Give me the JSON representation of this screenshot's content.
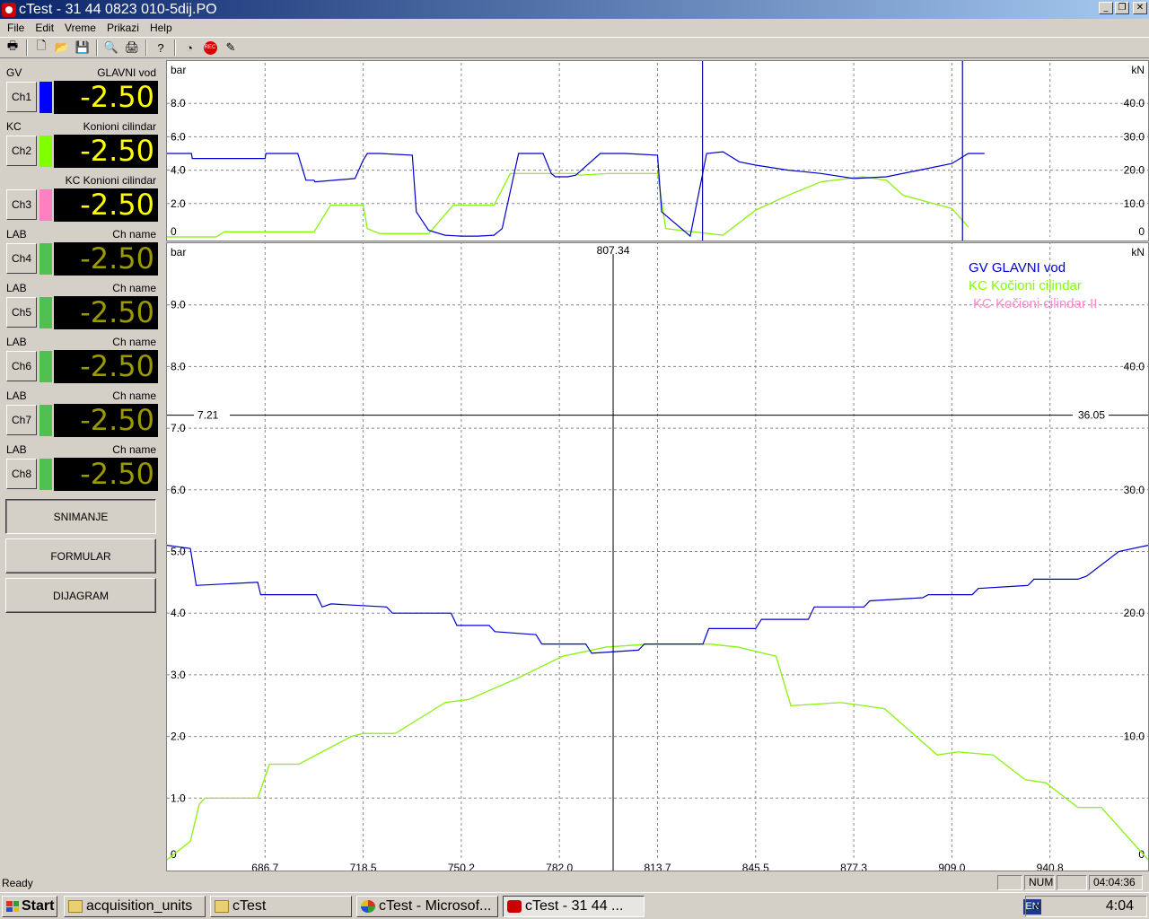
{
  "window": {
    "title": "cTest - 31 44 0823 010-5dij.PO"
  },
  "menu": [
    "File",
    "Edit",
    "Vreme",
    "Prikazi",
    "Help"
  ],
  "toolbar_icons": [
    "print-icon",
    "new-file-icon",
    "open-folder-icon",
    "save-icon",
    "print-preview-icon",
    "printer-icon",
    "help-icon",
    "gauge-icon",
    "rec-icon",
    "tool-icon"
  ],
  "channels": [
    {
      "code": "GV",
      "name": "GLAVNI vod",
      "button": "Ch1",
      "value": "-2.50",
      "color": "#0000ff",
      "active": true
    },
    {
      "code": "KC",
      "name": "Konioni cilindar",
      "button": "Ch2",
      "value": "-2.50",
      "color": "#80ff00",
      "active": true
    },
    {
      "code": "",
      "name": "KC Konioni cilindar",
      "button": "Ch3",
      "value": "-2.50",
      "color": "#ff80c0",
      "active": true
    },
    {
      "code": "LAB",
      "name": "Ch name",
      "button": "Ch4",
      "value": "-2.50",
      "color": "#50c050",
      "active": false
    },
    {
      "code": "LAB",
      "name": "Ch name",
      "button": "Ch5",
      "value": "-2.50",
      "color": "#50c050",
      "active": false
    },
    {
      "code": "LAB",
      "name": "Ch name",
      "button": "Ch6",
      "value": "-2.50",
      "color": "#50c050",
      "active": false
    },
    {
      "code": "LAB",
      "name": "Ch name",
      "button": "Ch7",
      "value": "-2.50",
      "color": "#50c050",
      "active": false
    },
    {
      "code": "LAB",
      "name": "Ch name",
      "button": "Ch8",
      "value": "-2.50",
      "color": "#50c050",
      "active": false
    }
  ],
  "buttons": {
    "snimanje": "SNIMANJE",
    "formular": "FORMULAR",
    "dijagram": "DIJAGRAM"
  },
  "status": {
    "ready": "Ready",
    "num": "NUM",
    "time": "04:04:36"
  },
  "taskbar": {
    "start": "Start",
    "tasks": [
      "acquisition_units",
      "cTest",
      "cTest - Microsof...",
      "cTest - 31 44 ..."
    ],
    "lang": "EN",
    "arrows": "«",
    "clock": "4:04"
  },
  "chart_data": [
    {
      "type": "line",
      "title": "",
      "ylabel_left": "bar",
      "ylabel_right": "kN",
      "xlim": [
        0,
        1200
      ],
      "ylim_left": [
        0,
        10
      ],
      "ylim_right": [
        0,
        50
      ],
      "x_ticks": [
        "120.0",
        "240.0",
        "360.0",
        "480.0",
        "600.0",
        "720.0",
        "840.0",
        "960.0",
        "1080.0"
      ],
      "y_ticks_left": [
        "0",
        "2.0",
        "4.0",
        "6.0",
        "8.0"
      ],
      "y_ticks_right": [
        "0",
        "10.0",
        "20.0",
        "30.0",
        "40.0"
      ],
      "grid": true,
      "cursors_x": [
        655,
        973
      ],
      "series": [
        {
          "color": "#0000cc",
          "x": [
            0,
            30,
            31,
            120,
            121,
            160,
            170,
            180,
            181,
            230,
            240,
            245,
            260,
            300,
            305,
            320,
            340,
            360,
            380,
            400,
            410,
            430,
            460,
            470,
            475,
            490,
            500,
            530,
            560,
            600,
            605,
            640,
            660,
            680,
            700,
            720,
            760,
            800,
            840,
            880,
            920,
            960,
            980,
            1000
          ],
          "y": [
            5.0,
            5.0,
            4.7,
            4.7,
            5.0,
            5.0,
            3.4,
            3.4,
            3.3,
            3.5,
            4.6,
            5.0,
            5.0,
            4.9,
            1.5,
            0.4,
            0.1,
            0.05,
            0.05,
            0.1,
            0.5,
            5.0,
            5.0,
            3.8,
            3.6,
            3.6,
            3.7,
            5.0,
            5.0,
            4.9,
            1.5,
            0.05,
            5.0,
            5.1,
            4.5,
            4.3,
            4.0,
            3.8,
            3.5,
            3.6,
            4.0,
            4.4,
            5.0,
            5.0
          ]
        },
        {
          "color": "#80ff00",
          "x": [
            0,
            60,
            70,
            100,
            180,
            200,
            240,
            245,
            260,
            320,
            350,
            400,
            420,
            500,
            505,
            540,
            600,
            610,
            680,
            720,
            760,
            800,
            850,
            880,
            900,
            960,
            980
          ],
          "y": [
            0,
            0,
            0.3,
            0.3,
            0.3,
            1.9,
            1.9,
            0.5,
            0.2,
            0.2,
            1.9,
            1.9,
            3.8,
            3.8,
            3.7,
            3.8,
            3.8,
            0.5,
            0.1,
            1.6,
            2.5,
            3.3,
            3.6,
            3.4,
            2.5,
            1.7,
            0.6
          ]
        },
        {
          "color": "#ff88cc",
          "x": [
            0,
            60,
            70,
            100,
            180,
            200,
            240,
            245,
            260,
            320,
            350,
            400,
            420,
            500,
            505,
            540,
            600,
            610,
            680,
            720,
            760,
            800,
            850,
            880,
            900,
            960,
            980
          ],
          "y": [
            0,
            0,
            0.3,
            0.3,
            0.3,
            1.9,
            1.9,
            0.5,
            0.2,
            0.2,
            1.9,
            1.9,
            3.8,
            3.8,
            3.7,
            3.8,
            3.8,
            0.5,
            0.1,
            1.6,
            2.5,
            3.3,
            3.6,
            3.4,
            2.5,
            1.7,
            0.6
          ]
        }
      ]
    },
    {
      "type": "line",
      "title": "",
      "ylabel_left": "bar",
      "ylabel_right": "kN",
      "xlim": [
        655,
        990
      ],
      "ylim_left": [
        0,
        10
      ],
      "ylim_right": [
        0,
        50
      ],
      "x_ticks": [
        "686.7",
        "718.5",
        "750.2",
        "782.0",
        "813.7",
        "845.5",
        "877.3",
        "909.0",
        "940.8"
      ],
      "y_ticks_left": [
        "0",
        "1.0",
        "2.0",
        "3.0",
        "4.0",
        "5.0",
        "6.0",
        "7.0",
        "8.0",
        "9.0"
      ],
      "y_ticks_right": [
        "0",
        "10.0",
        "20.0",
        "30.0",
        "40.0"
      ],
      "grid": true,
      "cursor_x_label": "807.34",
      "cursor_y_left": "7.21",
      "cursor_y_right": "36.05",
      "legend": [
        "GV GLAVNI vod",
        "KC Kočioni cilindar",
        "KC Kočioni cilindar II"
      ],
      "legend_position": "top-right",
      "series": [
        {
          "name": "GV GLAVNI vod",
          "color": "#0000cc",
          "x": [
            655,
            663,
            665,
            686,
            687,
            706,
            708,
            711,
            730,
            732,
            752,
            754,
            765,
            767,
            781,
            783,
            798,
            800,
            816,
            818,
            838,
            840,
            856,
            858,
            874,
            876,
            893,
            895,
            913,
            915,
            930,
            932,
            949,
            951,
            966,
            969,
            980,
            990
          ],
          "y": [
            5.1,
            5.05,
            4.45,
            4.5,
            4.3,
            4.3,
            4.1,
            4.15,
            4.1,
            4.0,
            4.0,
            3.8,
            3.8,
            3.7,
            3.65,
            3.5,
            3.5,
            3.35,
            3.4,
            3.5,
            3.5,
            3.75,
            3.75,
            3.9,
            3.9,
            4.1,
            4.1,
            4.2,
            4.25,
            4.3,
            4.3,
            4.4,
            4.45,
            4.55,
            4.55,
            4.6,
            5.0,
            5.1
          ]
        },
        {
          "name": "KC Kočioni cilindar",
          "color": "#80ff00",
          "x": [
            655,
            663,
            666,
            668,
            686,
            690,
            700,
            718,
            722,
            733,
            750,
            758,
            775,
            790,
            805,
            820,
            840,
            850,
            863,
            868,
            885,
            893,
            900,
            918,
            925,
            937,
            948,
            955,
            966,
            974,
            990
          ],
          "y": [
            0,
            0.3,
            0.9,
            1.0,
            1.0,
            1.55,
            1.55,
            2.0,
            2.05,
            2.05,
            2.55,
            2.6,
            2.95,
            3.3,
            3.45,
            3.5,
            3.5,
            3.45,
            3.3,
            2.5,
            2.55,
            2.5,
            2.45,
            1.7,
            1.75,
            1.7,
            1.3,
            1.25,
            0.85,
            0.85,
            0
          ]
        },
        {
          "name": "KC Kočioni cilindar II",
          "color": "#ff88cc",
          "x": [
            655,
            663,
            666,
            668,
            686,
            690,
            700,
            718,
            722,
            733,
            750,
            758,
            775,
            790,
            805,
            820,
            840,
            850,
            863,
            868,
            885,
            893,
            900,
            918,
            925,
            937,
            948,
            955,
            966,
            974,
            990
          ],
          "y": [
            0,
            0.3,
            0.9,
            1.0,
            1.0,
            1.55,
            1.55,
            2.0,
            2.05,
            2.05,
            2.55,
            2.6,
            2.95,
            3.3,
            3.45,
            3.5,
            3.5,
            3.45,
            3.3,
            2.5,
            2.55,
            2.5,
            2.45,
            1.7,
            1.75,
            1.7,
            1.3,
            1.25,
            0.85,
            0.85,
            0
          ]
        }
      ]
    }
  ]
}
